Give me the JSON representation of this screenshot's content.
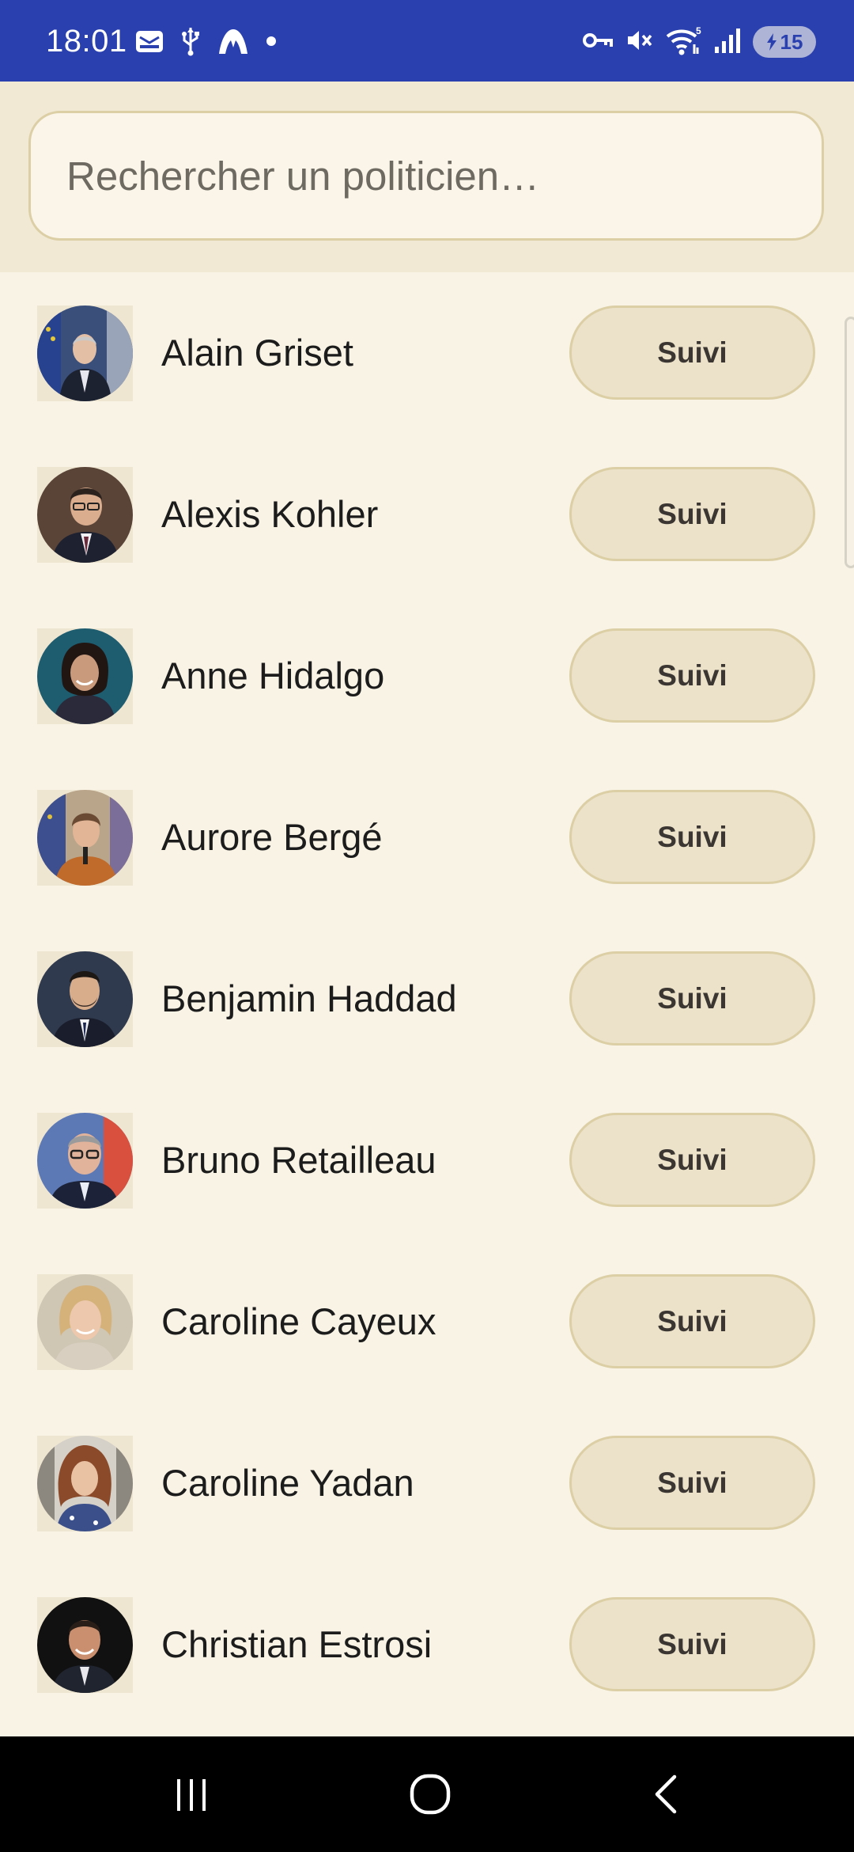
{
  "status_bar": {
    "time": "18:01",
    "battery_level": "15",
    "left_icons": [
      "email-notification-icon",
      "usb-icon",
      "vpn-app-icon",
      "dot-icon"
    ],
    "right_icons": [
      "vpn-key-icon",
      "vibrate-mute-icon",
      "wifi-icon",
      "signal-icon",
      "battery-icon"
    ],
    "background_color": "#2a40ae"
  },
  "search": {
    "placeholder": "Rechercher un politicien…",
    "value": ""
  },
  "politicians": [
    {
      "name": "Alain Griset",
      "button_label": "Suivi"
    },
    {
      "name": "Alexis Kohler",
      "button_label": "Suivi"
    },
    {
      "name": "Anne Hidalgo",
      "button_label": "Suivi"
    },
    {
      "name": "Aurore Bergé",
      "button_label": "Suivi"
    },
    {
      "name": "Benjamin Haddad",
      "button_label": "Suivi"
    },
    {
      "name": "Bruno Retailleau",
      "button_label": "Suivi"
    },
    {
      "name": "Caroline Cayeux",
      "button_label": "Suivi"
    },
    {
      "name": "Caroline Yadan",
      "button_label": "Suivi"
    },
    {
      "name": "Christian Estrosi",
      "button_label": "Suivi"
    }
  ],
  "navigation": {
    "buttons": [
      "recent-apps-icon",
      "home-icon",
      "back-icon"
    ]
  },
  "colors": {
    "page_background": "#f8f3e5",
    "search_area_background": "#f1e9d4",
    "button_background": "#ebe2c9",
    "button_border": "#dccfa6",
    "nav_bar": "#000000"
  }
}
